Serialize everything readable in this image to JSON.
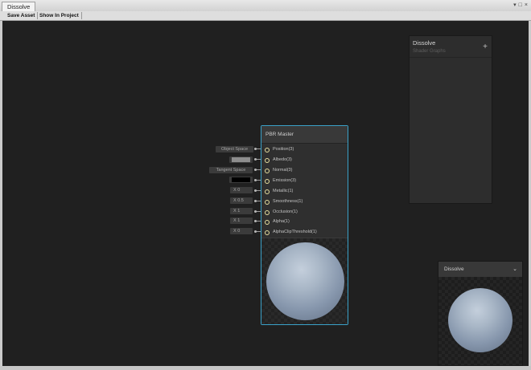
{
  "window": {
    "tab_title": "Dissolve",
    "controls": [
      "▾",
      "□",
      "×"
    ]
  },
  "toolbar": {
    "save_asset": "Save Asset",
    "show_in_project": "Show In Project"
  },
  "blackboard": {
    "title": "Dissolve",
    "subtitle": "Shader Graphs",
    "add_label": "+"
  },
  "master_node": {
    "title": "PBR Master",
    "ports": [
      "Position(3)",
      "Albedo(3)",
      "Normal(3)",
      "Emission(3)",
      "Metallic(1)",
      "Smoothness(1)",
      "Occlusion(1)",
      "Alpha(1)",
      "AlphaClipThreshold(1)"
    ]
  },
  "inputs": {
    "position": "Object Space",
    "albedo_color": "#8e8e8e",
    "normal": "Tangent Space",
    "emission_color": "#000000",
    "metallic": "X  0",
    "smoothness": "X  0.5",
    "occlusion": "X  1",
    "alpha": "X  1",
    "alpha_clip": "X  0"
  },
  "main_preview": {
    "title": "Dissolve",
    "chevron": "⌄"
  }
}
